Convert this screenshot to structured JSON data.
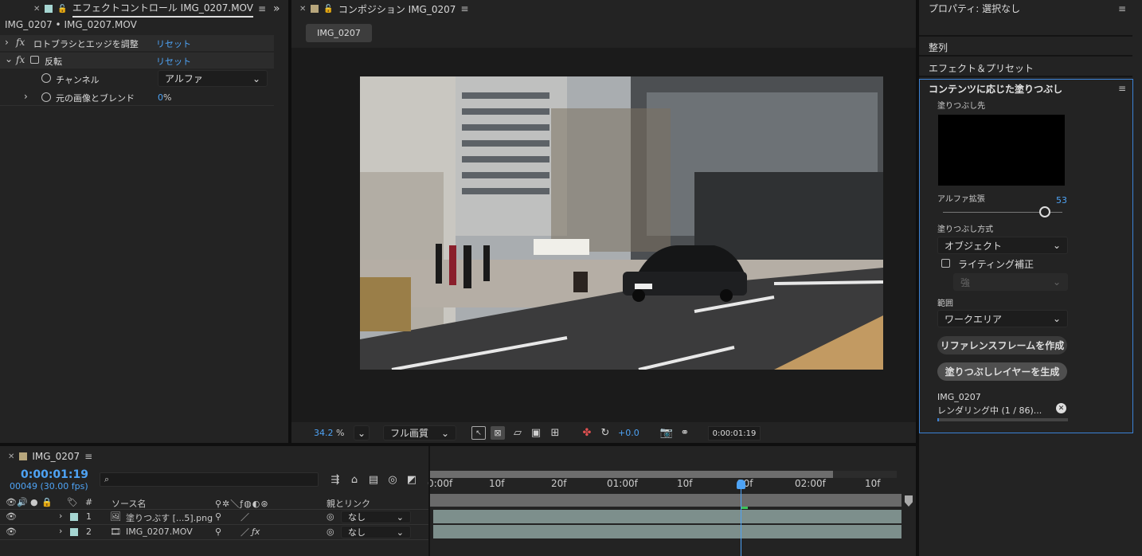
{
  "effects_panel": {
    "tab_title": "エフェクトコントロール IMG_0207.MOV",
    "breadcrumb": "IMG_0207 • IMG_0207.MOV",
    "effects": [
      {
        "name": "ロトブラシとエッジを調整",
        "reset": "リセット"
      },
      {
        "name": "反転",
        "reset": "リセット"
      }
    ],
    "channel_label": "チャンネル",
    "channel_value": "アルファ",
    "blend_label": "元の画像とブレンド",
    "blend_value": "0",
    "blend_unit": "%"
  },
  "composition_panel": {
    "tab_title": "コンポジション IMG_0207",
    "comp_tab": "IMG_0207",
    "zoom": "34.2",
    "zoom_unit": "%",
    "quality": "フル画質",
    "exposure": "+0.0",
    "timecode": "0:00:01:19"
  },
  "right_panel": {
    "properties_title": "プロパティ: 選択なし",
    "align": "整列",
    "effects_presets": "エフェクト＆プリセット",
    "caf_title": "コンテンツに応じた塗りつぶし",
    "fill_target": "塗りつぶし先",
    "alpha_expand_label": "アルファ拡張",
    "alpha_expand_value": "53",
    "alpha_expand_fraction": 0.85,
    "fill_method_label": "塗りつぶし方式",
    "fill_method_value": "オブジェクト",
    "lighting_label": "ライティング補正",
    "lighting_strength": "強",
    "range_label": "範囲",
    "range_value": "ワークエリア",
    "create_ref_button": "リファレンスフレームを作成",
    "generate_button": "塗りつぶしレイヤーを生成",
    "render_source": "IMG_0207",
    "render_status": "レンダリング中 (1 / 86)...",
    "render_progress": 0.012
  },
  "timeline": {
    "tab_title": "IMG_0207",
    "timecode": "0:00:01:19",
    "frame_info": "00049 (30.00 fps)",
    "search_placeholder": "",
    "col_number": "#",
    "col_source": "ソース名",
    "col_parent": "親とリンク",
    "ruler_labels": [
      "0:00f",
      "10f",
      "20f",
      "01:00f",
      "10f",
      "20f",
      "02:00f",
      "10f"
    ],
    "layers": [
      {
        "num": "1",
        "name": "塗りつぶす [...5].png",
        "parent": "なし"
      },
      {
        "num": "2",
        "name": "IMG_0207.MOV",
        "parent": "なし"
      }
    ]
  }
}
